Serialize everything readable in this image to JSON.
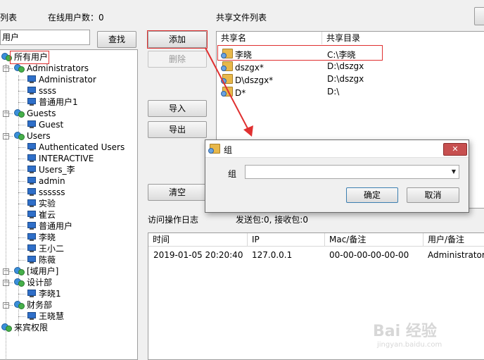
{
  "header": {
    "users_list_label": "列表",
    "online_users_label": "在线用户数：0",
    "share_list_label": "共享文件列表"
  },
  "search": {
    "value": "用户",
    "button_label": "查找"
  },
  "tree": [
    {
      "label": "所有用户",
      "level": 0,
      "kind": "group"
    },
    {
      "label": "Administrators",
      "level": 1,
      "kind": "group"
    },
    {
      "label": "Administrator",
      "level": 2,
      "kind": "user"
    },
    {
      "label": "ssss",
      "level": 2,
      "kind": "user"
    },
    {
      "label": "普通用户1",
      "level": 2,
      "kind": "user"
    },
    {
      "label": "Guests",
      "level": 1,
      "kind": "group"
    },
    {
      "label": "Guest",
      "level": 2,
      "kind": "user"
    },
    {
      "label": "Users",
      "level": 1,
      "kind": "group"
    },
    {
      "label": "Authenticated Users",
      "level": 2,
      "kind": "user"
    },
    {
      "label": "INTERACTIVE",
      "level": 2,
      "kind": "user"
    },
    {
      "label": "Users_李",
      "level": 2,
      "kind": "user"
    },
    {
      "label": "admin",
      "level": 2,
      "kind": "user"
    },
    {
      "label": "ssssss",
      "level": 2,
      "kind": "user"
    },
    {
      "label": "实验",
      "level": 2,
      "kind": "user"
    },
    {
      "label": "崔云",
      "level": 2,
      "kind": "user"
    },
    {
      "label": "普通用户",
      "level": 2,
      "kind": "user"
    },
    {
      "label": "李晓",
      "level": 2,
      "kind": "user"
    },
    {
      "label": "王小二",
      "level": 2,
      "kind": "user"
    },
    {
      "label": "陈薇",
      "level": 2,
      "kind": "user"
    },
    {
      "label": "[域用户]",
      "level": 1,
      "kind": "group"
    },
    {
      "label": "设计部",
      "level": 1,
      "kind": "group"
    },
    {
      "label": "李晓1",
      "level": 2,
      "kind": "user"
    },
    {
      "label": "财务部",
      "level": 1,
      "kind": "group"
    },
    {
      "label": "王晓慧",
      "level": 2,
      "kind": "user"
    },
    {
      "label": "来宾权限",
      "level": 0,
      "kind": "group"
    }
  ],
  "buttons": {
    "add": "添加",
    "delete": "删除",
    "import": "导入",
    "export": "导出",
    "clear": "清空"
  },
  "shares": {
    "columns": [
      "共享名",
      "共享目录"
    ],
    "rows": [
      {
        "name": "李晓",
        "dir": "C:\\李晓"
      },
      {
        "name": "dszgx*",
        "dir": "D:\\dszgx"
      },
      {
        "name": "D\\dszgx*",
        "dir": "D:\\dszgx"
      },
      {
        "name": "D*",
        "dir": "D:\\"
      }
    ]
  },
  "dialog": {
    "title": "组",
    "field_label": "组",
    "field_value": "",
    "ok_label": "确定",
    "cancel_label": "取消",
    "close_symbol": "✕"
  },
  "log": {
    "title": "访问操作日志",
    "stats": "发送包:0, 接收包:0",
    "columns": [
      "时间",
      "IP",
      "Mac/备注",
      "用户/备注"
    ],
    "rows": [
      {
        "time": "2019-01-05 20:20:40",
        "ip": "127.0.0.1",
        "mac": "00-00-00-00-00-00",
        "user": "Administrator"
      }
    ]
  },
  "watermark": {
    "brand": "Bai 经验",
    "url": "jingyan.baidu.com"
  },
  "colors": {
    "annotation_red": "#e03030",
    "dialog_title_bg": "#ffffff"
  }
}
